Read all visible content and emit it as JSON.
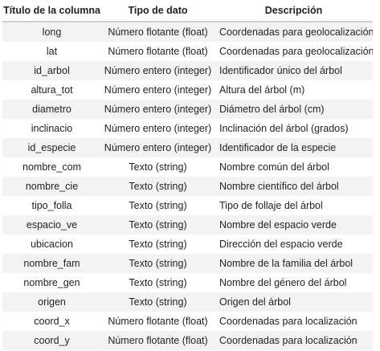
{
  "headers": {
    "column_name": "Título de la columna",
    "data_type": "Tipo de dato",
    "description": "Descripción"
  },
  "rows": [
    {
      "name": "long",
      "type": "Número flotante (float)",
      "desc": "Coordenadas para geolocalización"
    },
    {
      "name": "lat",
      "type": "Número flotante (float)",
      "desc": "Coordenadas para geolocalización"
    },
    {
      "name": "id_arbol",
      "type": "Número entero (integer)",
      "desc": "Identificador único del árbol"
    },
    {
      "name": "altura_tot",
      "type": "Número entero (integer)",
      "desc": "Altura del árbol (m)"
    },
    {
      "name": "diametro",
      "type": "Número entero (integer)",
      "desc": "Diámetro del árbol (cm)"
    },
    {
      "name": "inclinacio",
      "type": "Número entero (integer)",
      "desc": "Inclinación del árbol (grados)"
    },
    {
      "name": "id_especie",
      "type": "Número entero (integer)",
      "desc": "Identificador de la especie"
    },
    {
      "name": "nombre_com",
      "type": "Texto (string)",
      "desc": "Nombre común del árbol"
    },
    {
      "name": "nombre_cie",
      "type": "Texto (string)",
      "desc": "Nombre científico del árbol"
    },
    {
      "name": "tipo_folla",
      "type": "Texto (string)",
      "desc": "Tipo de follaje del árbol"
    },
    {
      "name": "espacio_ve",
      "type": "Texto (string)",
      "desc": "Nombre del espacio verde"
    },
    {
      "name": "ubicacion",
      "type": "Texto (string)",
      "desc": "Dirección del espacio verde"
    },
    {
      "name": "nombre_fam",
      "type": "Texto (string)",
      "desc": "Nombre de la familia del árbol"
    },
    {
      "name": "nombre_gen",
      "type": "Texto (string)",
      "desc": "Nombre del género del árbol"
    },
    {
      "name": "origen",
      "type": "Texto (string)",
      "desc": "Origen del árbol"
    },
    {
      "name": "coord_x",
      "type": "Número flotante (float)",
      "desc": "Coordenadas para localización"
    },
    {
      "name": "coord_y",
      "type": "Número flotante (float)",
      "desc": "Coordenadas para localización"
    }
  ]
}
